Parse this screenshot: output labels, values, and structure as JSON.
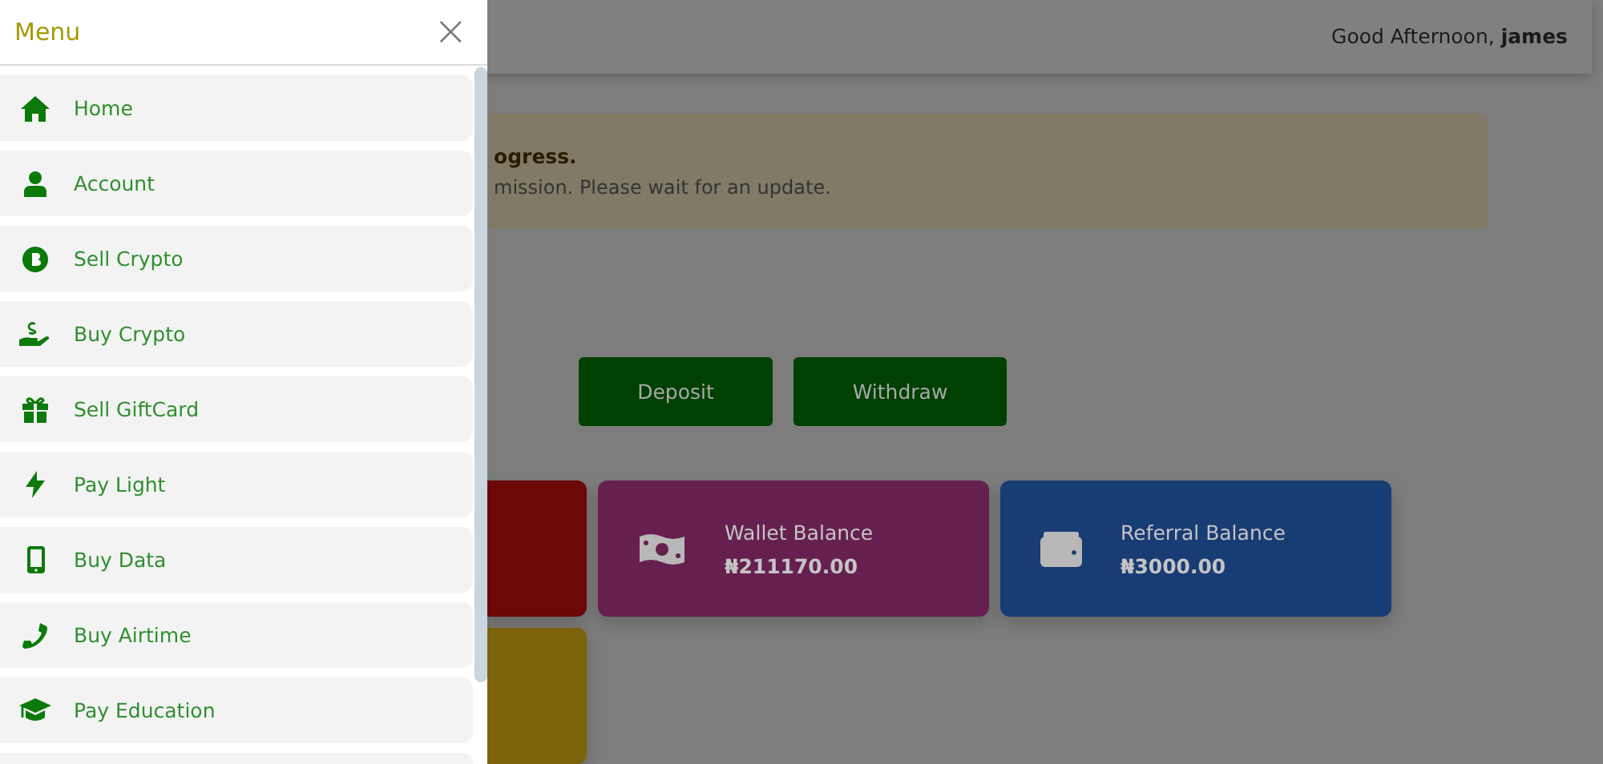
{
  "header": {
    "greeting": "Good Afternoon, **james**"
  },
  "alert": {
    "title": "ogress.",
    "message": "mission. Please wait for an update."
  },
  "actions": [
    "Deposit",
    "Withdraw"
  ],
  "cards": [
    {
      "color": "#6c0808"
    },
    {
      "color": "#66204f",
      "label": "Wallet Balance",
      "amount": "₦211170.00"
    },
    {
      "color": "#183c74",
      "label": "Referral Balance",
      "amount": "₦3000.00"
    },
    {
      "color": "#7c6208"
    }
  ],
  "menu": {
    "title": "Menu",
    "close": "×",
    "items": [
      {
        "label": "Home"
      },
      {
        "label": "Account"
      },
      {
        "label": "Sell Crypto"
      },
      {
        "label": "Buy Crypto"
      },
      {
        "label": "Sell GiftCard"
      },
      {
        "label": "Pay Light"
      },
      {
        "label": "Buy Data"
      },
      {
        "label": "Buy Airtime"
      },
      {
        "label": "Pay Education"
      }
    ]
  }
}
